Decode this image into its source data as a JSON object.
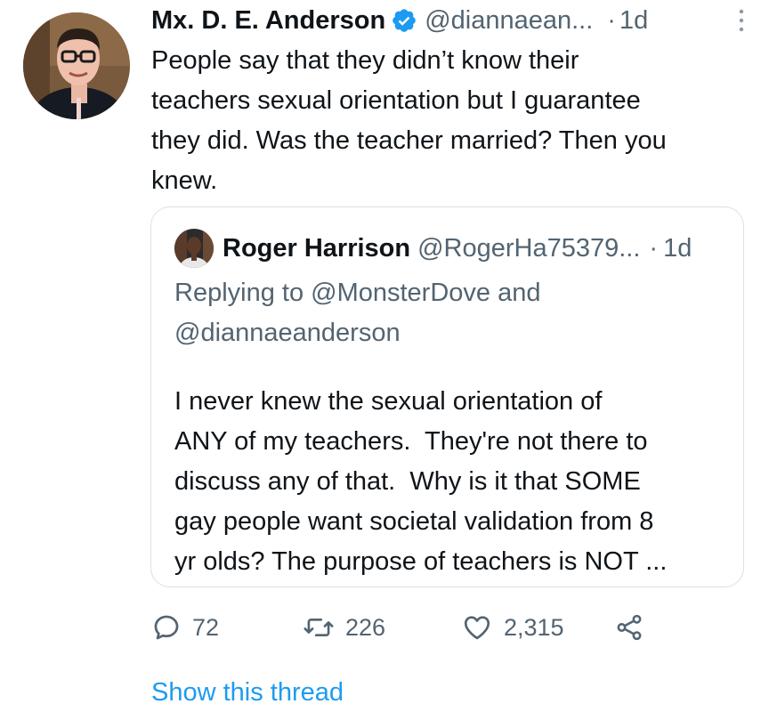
{
  "tweet": {
    "display_name": "Mx. D. E. Anderson",
    "handle": "@diannaean...",
    "separator": "·",
    "time": "1d",
    "verified_icon": "verified-badge-icon",
    "more_icon": "more-vertical-icon",
    "text": "People say that they didn’t know their\nteachers sexual orientation but I guarantee\nthey did. Was the teacher married? Then you\nknew.",
    "accent_color": "#1d9bf0"
  },
  "quote": {
    "display_name": "Roger Harrison",
    "handle": "@RogerHa75379...",
    "separator": "·",
    "time": "1d",
    "replying_line1": "Replying to @MonsterDove and",
    "replying_line2": "@diannaeanderson",
    "text": "I never knew the sexual orientation of\nANY of my teachers.  They're not there to\ndiscuss any of that.  Why is it that SOME\ngay people want societal validation from 8\nyr olds? The purpose of teachers is NOT ..."
  },
  "actions": {
    "reply": {
      "icon": "reply-icon",
      "count": "72"
    },
    "retweet": {
      "icon": "retweet-icon",
      "count": "226"
    },
    "like": {
      "icon": "heart-icon",
      "count": "2,315"
    },
    "share": {
      "icon": "share-icon"
    }
  },
  "show_thread_label": "Show this thread"
}
